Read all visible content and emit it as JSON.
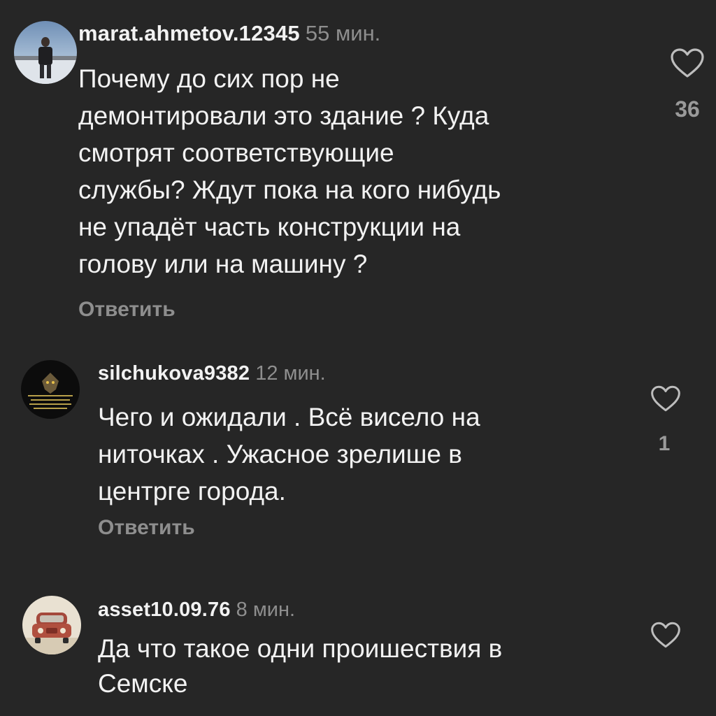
{
  "comments": [
    {
      "username": "marat.ahmetov.12345",
      "time": "55 мин.",
      "text": "Почему до сих пор не\nдемонтировали это здание ? Куда\nсмотрят соответствующие\nслужбы? Ждут пока на кого нибудь\nне упадёт часть конструкции на\nголову или на машину ?",
      "reply_label": "Ответить",
      "likes": "36",
      "avatar_icon": "user-photo-avatar"
    },
    {
      "username": "silchukova9382",
      "time": "12 мин.",
      "text": "Чего и ожидали . Всё висело на\nниточках . Ужасное зрелише в\nцентрге города.",
      "reply_label": "Ответить",
      "likes": "1",
      "avatar_icon": "dark-poster-avatar"
    },
    {
      "username": "asset10.09.76",
      "time": "8 мин.",
      "text": "Да что такое одни проишествия в\nСемске",
      "avatar_icon": "red-car-avatar"
    }
  ],
  "colors": {
    "background": "#262626",
    "text": "#f2f2f2",
    "muted": "#8e8e8e"
  },
  "icons": {
    "like": "heart-outline-icon"
  }
}
